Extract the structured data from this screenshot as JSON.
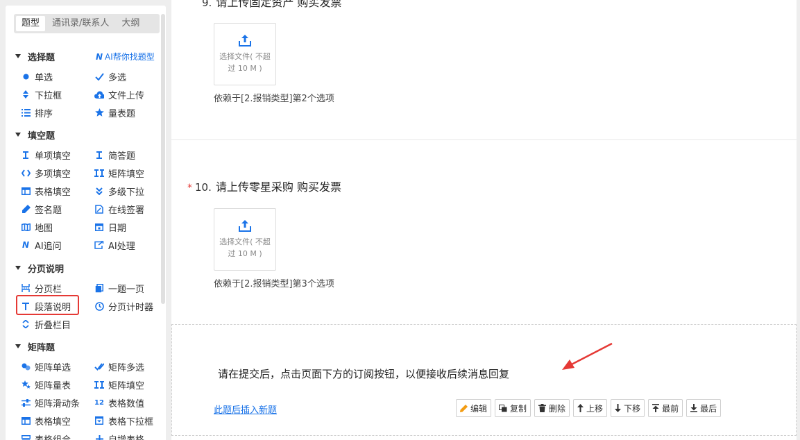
{
  "tabs": [
    "题型",
    "通讯录/联系人",
    "大纲"
  ],
  "sections": {
    "choice": {
      "title": "选择题",
      "ai_help": "AI帮你找题型",
      "ai_n": "N"
    },
    "fill": {
      "title": "填空题"
    },
    "page": {
      "title": "分页说明"
    },
    "matrix": {
      "title": "矩阵题"
    }
  },
  "items": {
    "single": "单选",
    "multi": "多选",
    "dropdown": "下拉框",
    "file_upload": "文件上传",
    "sort": "排序",
    "scale": "量表题",
    "single_fill": "单项填空",
    "short_answer": "简答题",
    "multi_fill": "多项填空",
    "matrix_fill": "矩阵填空",
    "table_fill": "表格填空",
    "cascade_dropdown": "多级下拉",
    "signature": "签名题",
    "online_sign": "在线签署",
    "map": "地图",
    "date": "日期",
    "ai_followup": "AI追问",
    "ai_process": "AI处理",
    "page_bar": "分页栏",
    "one_per_page": "一题一页",
    "paragraph": "段落说明",
    "page_timer": "分页计时器",
    "fold": "折叠栏目",
    "matrix_single": "矩阵单选",
    "matrix_multi": "矩阵多选",
    "matrix_scale": "矩阵量表",
    "matrix_fill2": "矩阵填空",
    "matrix_slider": "矩阵滑动条",
    "table_number": "表格数值",
    "table_fill2": "表格填空",
    "table_dropdown": "表格下拉框",
    "table_group": "表格组合",
    "auto_table": "自增表格",
    "table_number_ico": "12"
  },
  "q9": {
    "num": "9.",
    "title": "请上传固定资产 购买发票",
    "upload": "选择文件( 不超过 10 M )",
    "dep": "依赖于[2.报销类型]第2个选项"
  },
  "q10": {
    "req": "*",
    "num": "10.",
    "title": "请上传零星采购 购买发票",
    "upload": "选择文件( 不超过 10 M )",
    "dep": "依赖于[2.报销类型]第3个选项"
  },
  "para_block": {
    "text": "请在提交后，点击页面下方的订阅按钮，以便接收后续消息回复",
    "insert": "此题后插入新题",
    "buttons": [
      "编辑",
      "复制",
      "删除",
      "上移",
      "下移",
      "最前",
      "最后"
    ]
  },
  "colors": {
    "accent": "#1a73e8",
    "required": "#e53935",
    "highlight": "#e53935",
    "edit_icon": "#f39c12"
  }
}
